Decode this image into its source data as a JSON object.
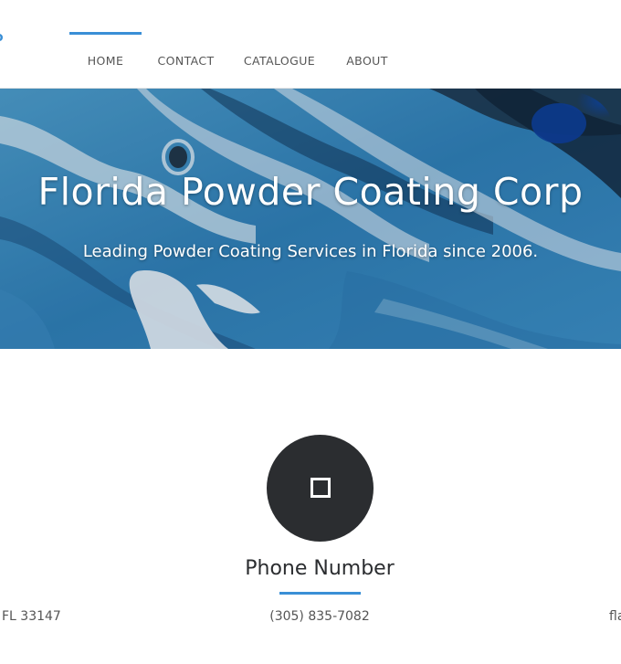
{
  "header": {
    "logo_fragment": "o",
    "nav": [
      {
        "label": "HOME",
        "active": true
      },
      {
        "label": "CONTACT",
        "active": false
      },
      {
        "label": "CATALOGUE",
        "active": false
      },
      {
        "label": "ABOUT",
        "active": false
      }
    ]
  },
  "hero": {
    "title": "Florida Powder Coating Corp",
    "subtitle": "Leading Powder Coating Services in Florida since 2006."
  },
  "contact": {
    "left_partial": "FL 33147",
    "center": {
      "icon": "square-icon",
      "title": "Phone Number",
      "value": "(305) 835-7082"
    },
    "right_partial": "fla"
  },
  "colors": {
    "accent": "#3a8fd6",
    "icon_circle": "#2b2d30",
    "nav_text": "#555555",
    "body_text": "#555555",
    "hero_text": "#ffffff"
  }
}
